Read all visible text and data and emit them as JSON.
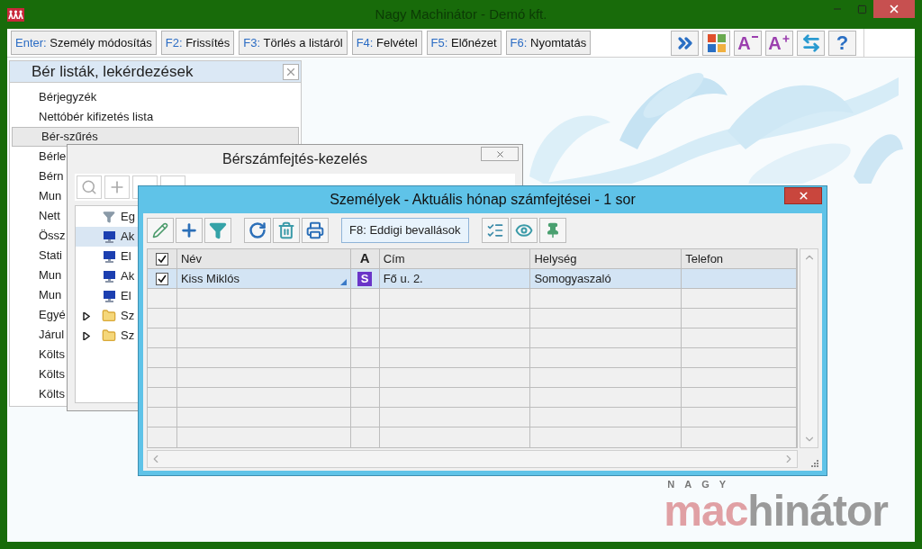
{
  "window": {
    "title": "Nagy Machinátor - Demó kft."
  },
  "toolbar": {
    "buttons": [
      {
        "key": "Enter:",
        "label": "Személy módosítás"
      },
      {
        "key": "F2:",
        "label": "Frissítés"
      },
      {
        "key": "F3:",
        "label": "Törlés a listáról"
      },
      {
        "key": "F4:",
        "label": "Felvétel"
      },
      {
        "key": "F5:",
        "label": "Előnézet"
      },
      {
        "key": "F6:",
        "label": "Nyomtatás"
      }
    ],
    "icons": [
      {
        "kind": "chevrons"
      },
      {
        "kind": "tiles"
      },
      {
        "kind": "font-smaller",
        "glyph": "A"
      },
      {
        "kind": "font-larger",
        "glyph": "A"
      },
      {
        "kind": "swap"
      },
      {
        "kind": "help",
        "glyph": "?"
      }
    ]
  },
  "side_panel": {
    "title": "Bér listák, lekérdezések",
    "items": [
      {
        "label": "Bérjegyzék",
        "selected": false
      },
      {
        "label": "Nettóbér kifizetés lista",
        "selected": false
      },
      {
        "label": "Bér-szűrés",
        "selected": true
      },
      {
        "label": "Bérle",
        "selected": false
      },
      {
        "label": "Bérn",
        "selected": false
      },
      {
        "label": "Mun",
        "selected": false
      },
      {
        "label": "Nett",
        "selected": false
      },
      {
        "label": "Össz",
        "selected": false
      },
      {
        "label": "Stati",
        "selected": false
      },
      {
        "label": "Mun",
        "selected": false
      },
      {
        "label": "Mun",
        "selected": false
      },
      {
        "label": "Egyé",
        "selected": false
      },
      {
        "label": "Járul",
        "selected": false
      },
      {
        "label": "Költs",
        "selected": false
      },
      {
        "label": "Költs",
        "selected": false
      },
      {
        "label": "Költs",
        "selected": false
      }
    ]
  },
  "payroll_window": {
    "title": "Bérszámfejtés-kezelés",
    "tree": [
      {
        "kind": "filter",
        "label": "Eg",
        "selected": false
      },
      {
        "kind": "monitor",
        "label": "Ak",
        "selected": true
      },
      {
        "kind": "monitor",
        "label": "El",
        "selected": false
      },
      {
        "kind": "monitor",
        "label": "Ak",
        "selected": false
      },
      {
        "kind": "monitor",
        "label": "El",
        "selected": false
      },
      {
        "kind": "folder",
        "label": "Sz",
        "selected": false,
        "expanded": false
      },
      {
        "kind": "folder",
        "label": "Sz",
        "selected": false,
        "expanded": false
      }
    ]
  },
  "persons_window": {
    "title": "Személyek - Aktuális hónap számfejtései - 1 sor",
    "toolbar": [
      [
        {
          "kind": "pencil"
        },
        {
          "kind": "plus"
        },
        {
          "kind": "filter"
        }
      ],
      [
        {
          "kind": "refresh"
        },
        {
          "kind": "trash"
        },
        {
          "kind": "print"
        }
      ],
      [
        {
          "kind": "text",
          "label": "F8: Eddigi bevallások"
        }
      ],
      [
        {
          "kind": "list"
        },
        {
          "kind": "eye"
        },
        {
          "kind": "pin"
        }
      ]
    ],
    "table": {
      "header_checked": true,
      "columns": [
        "Név",
        "A",
        "Cím",
        "Helység",
        "Telefon"
      ],
      "rows": [
        {
          "checked": true,
          "selected": true,
          "name": "Kiss Miklós",
          "badge": "S",
          "address": "Fő u. 2.",
          "city": "Somogyaszaló"
        }
      ]
    }
  },
  "logo": {
    "top": "NAGY",
    "accent": "mac",
    "rest": "hinátor"
  }
}
